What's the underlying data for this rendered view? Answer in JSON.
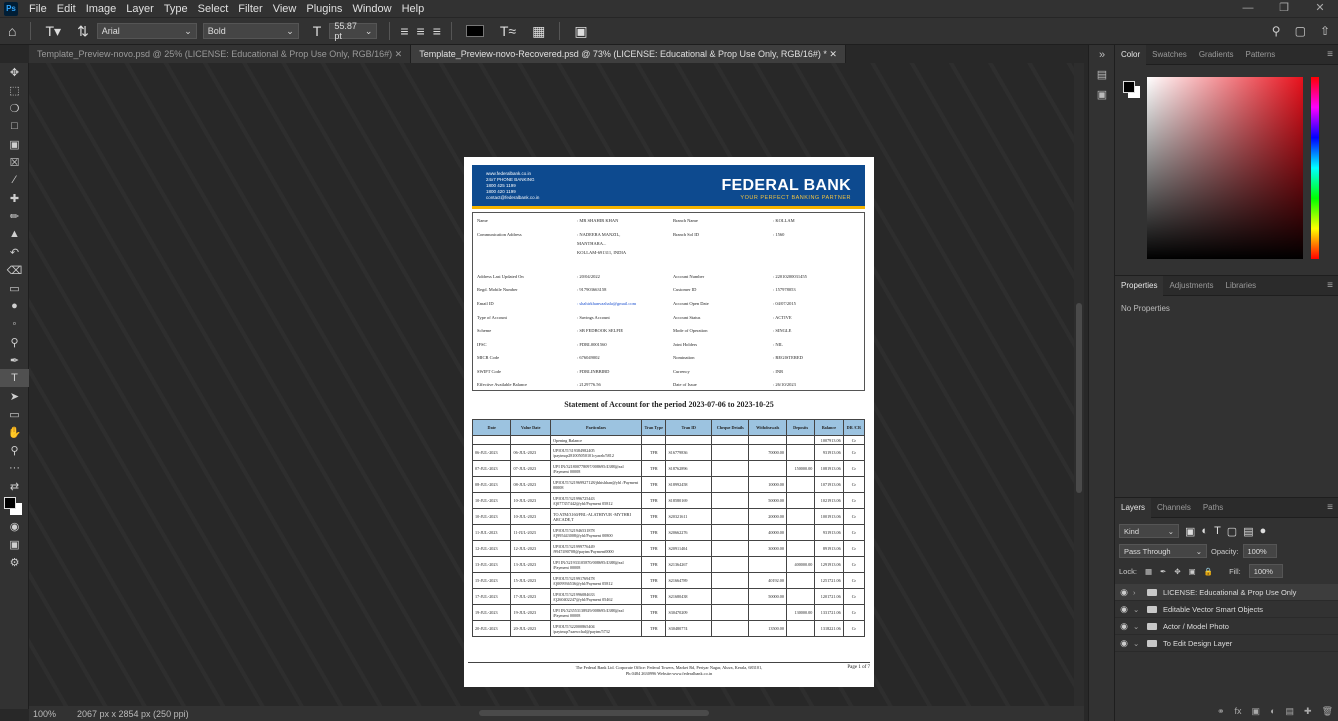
{
  "app": {
    "logo": "Ps"
  },
  "menu": [
    "File",
    "Edit",
    "Image",
    "Layer",
    "Type",
    "Select",
    "Filter",
    "View",
    "Plugins",
    "Window",
    "Help"
  ],
  "options": {
    "font": "Arial",
    "style": "Bold",
    "size": "55.87 pt"
  },
  "tabs": [
    {
      "label": "Template_Preview-novo.psd @ 25% (LICENSE: Educational & Prop Use Only, RGB/16#)"
    },
    {
      "label": "Template_Preview-novo-Recovered.psd @ 73% (LICENSE: Educational & Prop Use Only, RGB/16#) *"
    }
  ],
  "status": {
    "zoom": "100%",
    "dims": "2067 px x 2854 px (250 ppi)"
  },
  "document": {
    "contact_lines": [
      "www.federalbank.co.in",
      "24x7 PHONE BANKING",
      "1800 425 1199",
      "1800 420 1199",
      "contact@federalbank.co.in"
    ],
    "brand": "FEDERAL BANK",
    "tagline": "YOUR PERFECT BANKING PARTNER",
    "left_info": [
      {
        "k": "Name",
        "v": ": MR SHAHIR KHAN"
      },
      {
        "k": "Communication Address",
        "v": ": NADEERA MANZIL,"
      },
      {
        "k": "",
        "v": "  MANTHARA..."
      },
      {
        "k": "",
        "v": "  KOLLAM-691311, INDIA"
      },
      {
        "k": "Address Last Updated On",
        "v": ": 20/04/2022"
      },
      {
        "k": "Regd. Mobile Number",
        "v": ": 917903663158"
      },
      {
        "k": "Email ID",
        "v": ": shahirkhanvazhala@gmail.com"
      },
      {
        "k": "Type of Account",
        "v": ": Savings Account"
      },
      {
        "k": "Scheme",
        "v": ": SB FEDBOOK SELFIE"
      },
      {
        "k": "IFSC",
        "v": ": FDRL0001560"
      },
      {
        "k": "MICR Code",
        "v": ": 676049002"
      },
      {
        "k": "SWIFT Code",
        "v": ": FDRLINBBIBD"
      },
      {
        "k": "Effective Available Balance",
        "v": ": 2129776.56"
      }
    ],
    "right_info": [
      {
        "k": "Branch Name",
        "v": ": KOLLAM"
      },
      {
        "k": "Branch Sol ID",
        "v": ": 1560"
      },
      {
        "k": "Account Number",
        "v": ": 22010200031455"
      },
      {
        "k": "Customer ID",
        "v": ": 157978053"
      },
      {
        "k": "Account Open Date",
        "v": ": 04/07/2015"
      },
      {
        "k": "Account Status",
        "v": ": ACTIVE"
      },
      {
        "k": "Mode of Operation",
        "v": ": SINGLE"
      },
      {
        "k": "Joint Holders",
        "v": ": NIL"
      },
      {
        "k": "Nomination",
        "v": ": REGISTERED"
      },
      {
        "k": "Currency",
        "v": ": INR"
      },
      {
        "k": "Date of Issue",
        "v": ": 26/10/2023"
      }
    ],
    "statement_title": "Statement of Account for the period 2023-07-06 to 2023-10-25",
    "table_headers": [
      "Date",
      "Value Date",
      "Particulars",
      "Tran Type",
      "Tran ID",
      "Cheque Details",
      "Withdrawals",
      "Deposits",
      "Balance",
      "DR /CR"
    ],
    "opening": {
      "label": "Opening Balance",
      "balance": "1007913.06",
      "drcr": "Cr"
    },
    "rows": [
      [
        "06-JUL-2023",
        "06-JUL-2023",
        "UPIOUT/319384982405 /paytmqr281005050101cyarzb/5812",
        "TFR",
        "S16779836",
        "",
        "70000.00",
        "",
        "931913.06",
        "Cr"
      ],
      [
        "07-JUL-2023",
        "07-JUL-2023",
        "UPI IN/321800778097/008695/4388@axl /Payment 00008",
        "TFR",
        "S18762896",
        "",
        "",
        "150000.00",
        "1081913.06",
        "Cr"
      ],
      [
        "08-JUL-2023",
        "08-JUL-2023",
        "UPIOUT/321969927128/jbhishhan@ybl /Payment 00008",
        "TFR",
        "S18992458",
        "",
        "10000.00",
        "",
        "1071913.06",
        "Cr"
      ],
      [
        "10-JUL-2023",
        "10-JUL-2023",
        "UPIOUT/321996725443 /Q077357442@ybl/Payment 05812",
        "TFR",
        "S18580169",
        "",
        "50000.00",
        "",
        "1021913.06",
        "Cr"
      ],
      [
        "10-JUL-2023",
        "10-JUL-2023",
        "TO ATM/3160/FBL-ALATHIYUR -MYTHRI ARCADE,T",
        "TFR",
        "S20321611",
        "",
        "20000.00",
        "",
        "1001913.06",
        "Cr"
      ],
      [
        "11-JUL-2023",
        "11-JUL-2023",
        "UPIOUT/321946531878 /Q995443008@ybl/Payment 00800",
        "TFR",
        "S20662276",
        "",
        "40000.00",
        "",
        "931913.06",
        "Cr"
      ],
      [
        "12-JUL-2023",
        "12-JUL-2023",
        "UPIOUT/321999776449 /9947490708@paytm/Payment0000",
        "TFR",
        "S20911404",
        "",
        "30000.00",
        "",
        "891913.06",
        "Cr"
      ],
      [
        "13-JUL-2023",
        "13-JUL-2023",
        "UPI IN/321933105870/008695/4388@axl /Payment 00008",
        "TFR",
        "S21364267",
        "",
        "",
        "400000.00",
        "1291913.06",
        "Cr"
      ],
      [
        "15-JUL-2023",
        "15-JUL-2023",
        "UPIOUT/321991769478 /Q009936536@ybl/Payment 05812",
        "TFR",
        "S21664789",
        "",
        "40192.00",
        "",
        "1251721.06",
        "Cr"
      ],
      [
        "17-JUL-2023",
        "17-JUL-2023",
        "UPIOUT/321996084633 /Q260402247@ybl/Payment 05462",
        "TFR",
        "S21680438",
        "",
        "50000.00",
        "",
        "1201721.06",
        "Cr"
      ],
      [
        "19-JUL-2023",
        "19-JUL-2023",
        "UPI IN/323553138929/008695/4388@axl /Payment 00008",
        "TFR",
        "S30470209",
        "",
        "",
        "130000.00",
        "1331721.06",
        "Cr"
      ],
      [
        "20-JUL-2023",
        "20-JUL-2023",
        "UPIOUT/322000865404 /paytmqr7xaewchal@paytm/5732",
        "TFR",
        "S30480774",
        "",
        "13500.00",
        "",
        "1318221.06",
        "Cr"
      ]
    ],
    "footer_line1": "The Federal Bank Ltd. Corporate Office: Federal Towers, Market Rd, Periyar Nagar, Aluva, Kerala, 683101,",
    "footer_line2": "Ph:0484 2630996 Website:www.federalbank.co.in",
    "page": "Page 1 of 7"
  },
  "panels": {
    "color_tabs": [
      "Color",
      "Swatches",
      "Gradients",
      "Patterns"
    ],
    "prop_tabs": [
      "Properties",
      "Adjustments",
      "Libraries"
    ],
    "no_properties": "No Properties",
    "layer_tabs": [
      "Layers",
      "Channels",
      "Paths"
    ],
    "kind": "Kind",
    "blend": "Pass Through",
    "opacity_label": "Opacity:",
    "opacity": "100%",
    "lock_label": "Lock:",
    "fill_label": "Fill:",
    "fill": "100%",
    "layers": [
      "LICENSE: Educational & Prop Use Only",
      "Editable Vector Smart Objects",
      "Actor / Model Photo",
      "To Edit Design Layer"
    ]
  },
  "colors": {
    "bank_blue": "#0d4a8f",
    "bank_gold": "#f4b400",
    "table_header": "#9cc3e0"
  }
}
